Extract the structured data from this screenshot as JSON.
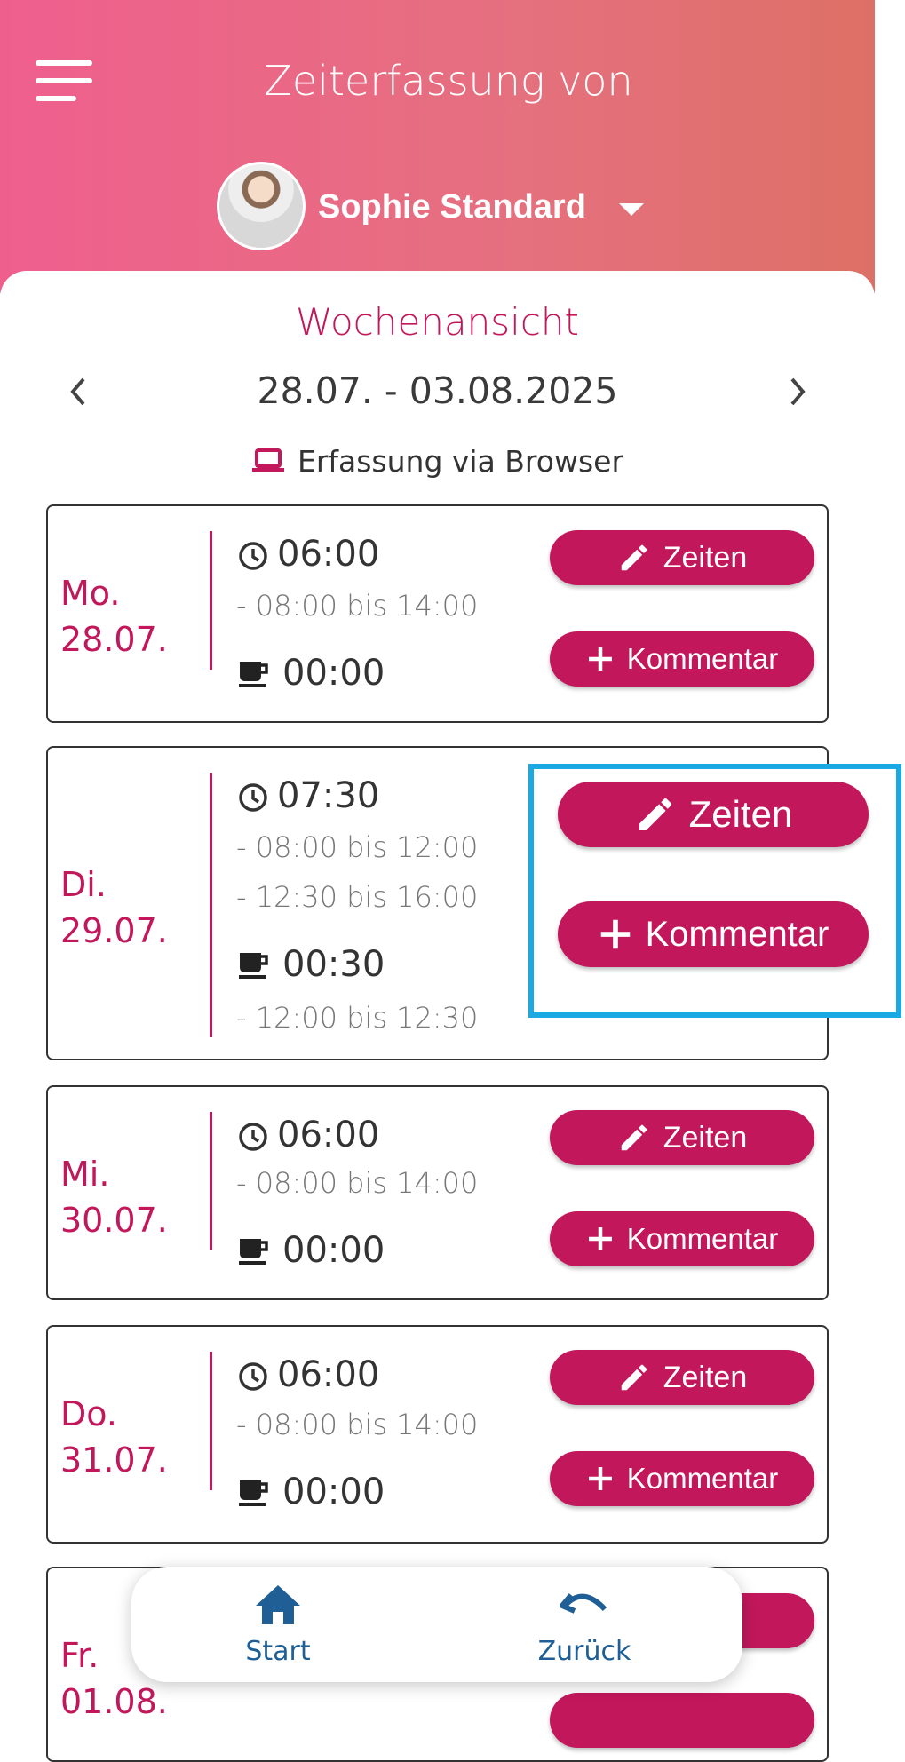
{
  "header": {
    "title": "Zeiterfassung von",
    "user_name": "Sophie Standard"
  },
  "week": {
    "section_title": "Wochenansicht",
    "range": "28.07. - 03.08.2025",
    "prev_icon": "chevron-left-icon",
    "next_icon": "chevron-right-icon",
    "source_label": "Erfassung via Browser"
  },
  "buttons": {
    "times_label": "Zeiten",
    "comment_label": "Kommentar"
  },
  "days": [
    {
      "weekday": "Mo.",
      "date": "28.07.",
      "total": "06:00",
      "intervals": [
        "- 08:00 bis 14:00"
      ],
      "break_total": "00:00",
      "break_intervals": []
    },
    {
      "weekday": "Di.",
      "date": "29.07.",
      "total": "07:30",
      "intervals": [
        "- 08:00 bis 12:00",
        "- 12:30 bis 16:00"
      ],
      "break_total": "00:30",
      "break_intervals": [
        "- 12:00 bis 12:30"
      ]
    },
    {
      "weekday": "Mi.",
      "date": "30.07.",
      "total": "06:00",
      "intervals": [
        "- 08:00 bis 14:00"
      ],
      "break_total": "00:00",
      "break_intervals": []
    },
    {
      "weekday": "Do.",
      "date": "31.07.",
      "total": "06:00",
      "intervals": [
        "- 08:00 bis 14:00"
      ],
      "break_total": "00:00",
      "break_intervals": []
    },
    {
      "weekday": "Fr.",
      "date": "01.08."
    }
  ],
  "bottom_nav": {
    "start_label": "Start",
    "back_label": "Zurück"
  },
  "colors": {
    "accent": "#c2185b",
    "header_gradient_start": "#ef5f8e",
    "header_gradient_end": "#dd7066",
    "highlight_border": "#1aa9e3",
    "nav_text": "#1f5f96"
  }
}
